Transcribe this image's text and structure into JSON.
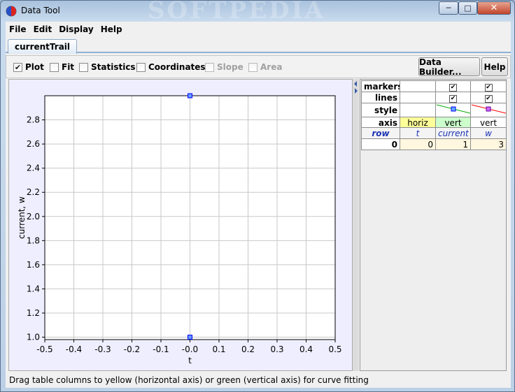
{
  "window": {
    "title": "Data Tool",
    "watermark": "SOFTPEDIA"
  },
  "menubar": [
    "File",
    "Edit",
    "Display",
    "Help"
  ],
  "tab": {
    "label": "currentTrail"
  },
  "toolbar": {
    "checkboxes": [
      {
        "label": "Plot",
        "checked": true,
        "enabled": true
      },
      {
        "label": "Fit",
        "checked": false,
        "enabled": true
      },
      {
        "label": "Statistics",
        "checked": false,
        "enabled": true
      },
      {
        "label": "Coordinates",
        "checked": false,
        "enabled": true
      },
      {
        "label": "Slope",
        "checked": false,
        "enabled": false
      },
      {
        "label": "Area",
        "checked": false,
        "enabled": false
      }
    ],
    "data_builder_label": "Data Builder...",
    "help_label": "Help"
  },
  "props_table": {
    "rows": [
      "markers",
      "lines",
      "style",
      "axis"
    ],
    "markers": [
      false,
      true,
      true
    ],
    "lines": [
      false,
      true,
      true
    ],
    "axis": [
      "horiz",
      "vert",
      "vert"
    ],
    "colors": {
      "horiz": "#ffff99",
      "vert_green": "#ccffcc",
      "series1": "#00aa00",
      "series2": "#ff0000"
    }
  },
  "data_table": {
    "headers": [
      "row",
      "t",
      "current",
      "w"
    ],
    "rows": [
      [
        "0",
        "0",
        "1",
        "3"
      ]
    ]
  },
  "chart_data": {
    "type": "scatter",
    "xlabel": "t",
    "ylabel": "current, w",
    "xlim": [
      -0.5,
      0.5
    ],
    "ylim": [
      0.98,
      3.0
    ],
    "xticks": [
      "-0.5",
      "-0.4",
      "-0.3",
      "-0.2",
      "-0.1",
      "-0.0",
      "0.1",
      "0.2",
      "0.3",
      "0.4",
      "0.5"
    ],
    "yticks": [
      "1.0",
      "1.2",
      "1.4",
      "1.6",
      "1.8",
      "2.0",
      "2.2",
      "2.4",
      "2.6",
      "2.8"
    ],
    "grid": true,
    "series": [
      {
        "name": "current",
        "x": [
          0
        ],
        "y": [
          1
        ],
        "color": "#0000ff"
      },
      {
        "name": "w",
        "x": [
          0
        ],
        "y": [
          3
        ],
        "color": "#0000ff"
      }
    ]
  },
  "status": "Drag table columns to yellow (horizontal axis) or green (vertical axis) for curve fitting"
}
